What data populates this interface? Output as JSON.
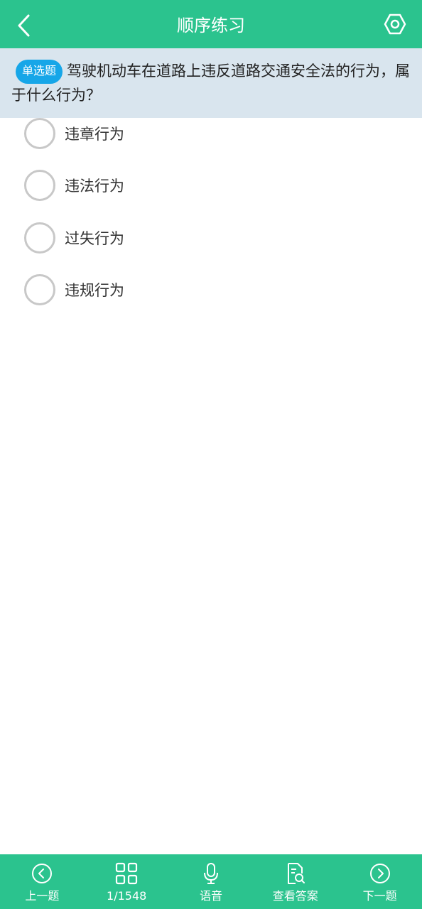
{
  "header": {
    "title": "顺序练习",
    "back_icon": "chevron-left-icon",
    "settings_icon": "hexagon-settings-icon",
    "color": "#2bc38e"
  },
  "question": {
    "type_badge": "单选题",
    "text": "驾驶机动车在道路上违反道路交通安全法的行为，属于什么行为？",
    "badge_color": "#16a6e8",
    "background": "#d9e5ee"
  },
  "options": [
    {
      "label": "违章行为",
      "selected": false
    },
    {
      "label": "违法行为",
      "selected": false
    },
    {
      "label": "过失行为",
      "selected": false
    },
    {
      "label": "违规行为",
      "selected": false
    }
  ],
  "bottom_nav": {
    "prev": {
      "label": "上一题",
      "icon": "circle-chevron-left-icon"
    },
    "progress": {
      "label": "1/1548",
      "icon": "grid-icon"
    },
    "voice": {
      "label": "语音",
      "icon": "microphone-icon"
    },
    "answer": {
      "label": "查看答案",
      "icon": "document-search-icon"
    },
    "next": {
      "label": "下一题",
      "icon": "circle-chevron-right-icon"
    }
  }
}
